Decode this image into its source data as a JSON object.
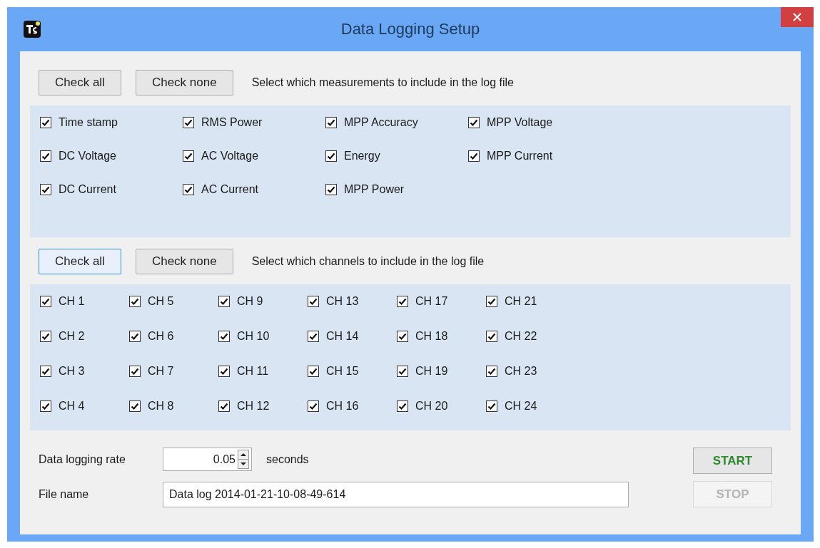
{
  "window": {
    "title": "Data Logging Setup"
  },
  "measurements": {
    "buttons": [
      {
        "label": "Check all",
        "focused": false
      },
      {
        "label": "Check none",
        "focused": false
      }
    ],
    "hint": "Select which measurements to include in the log file",
    "items": [
      {
        "label": "Time stamp",
        "checked": true
      },
      {
        "label": "DC Voltage",
        "checked": true
      },
      {
        "label": "DC Current",
        "checked": true
      },
      {
        "label": "RMS Power",
        "checked": true
      },
      {
        "label": "AC Voltage",
        "checked": true
      },
      {
        "label": "AC Current",
        "checked": true
      },
      {
        "label": "MPP Accuracy",
        "checked": true
      },
      {
        "label": "Energy",
        "checked": true
      },
      {
        "label": "MPP Power",
        "checked": true
      },
      {
        "label": "MPP Voltage",
        "checked": true
      },
      {
        "label": "MPP Current",
        "checked": true
      }
    ]
  },
  "channels": {
    "buttons": [
      {
        "label": "Check all",
        "focused": true
      },
      {
        "label": "Check none",
        "focused": false
      }
    ],
    "hint": "Select which channels to include in the log file",
    "items": [
      {
        "label": "CH 1",
        "checked": true
      },
      {
        "label": "CH 2",
        "checked": true
      },
      {
        "label": "CH 3",
        "checked": true
      },
      {
        "label": "CH 4",
        "checked": true
      },
      {
        "label": "CH 5",
        "checked": true
      },
      {
        "label": "CH 6",
        "checked": true
      },
      {
        "label": "CH 7",
        "checked": true
      },
      {
        "label": "CH 8",
        "checked": true
      },
      {
        "label": "CH 9",
        "checked": true
      },
      {
        "label": "CH 10",
        "checked": true
      },
      {
        "label": "CH 11",
        "checked": true
      },
      {
        "label": "CH 12",
        "checked": true
      },
      {
        "label": "CH 13",
        "checked": true
      },
      {
        "label": "CH 14",
        "checked": true
      },
      {
        "label": "CH 15",
        "checked": true
      },
      {
        "label": "CH 16",
        "checked": true
      },
      {
        "label": "CH 17",
        "checked": true
      },
      {
        "label": "CH 18",
        "checked": true
      },
      {
        "label": "CH 19",
        "checked": true
      },
      {
        "label": "CH 20",
        "checked": true
      },
      {
        "label": "CH 21",
        "checked": true
      },
      {
        "label": "CH 22",
        "checked": true
      },
      {
        "label": "CH 23",
        "checked": true
      },
      {
        "label": "CH 24",
        "checked": true
      }
    ]
  },
  "rate": {
    "label": "Data logging rate",
    "value": "0.05",
    "unit": "seconds"
  },
  "file": {
    "label": "File name",
    "value": "Data log 2014-01-21-10-08-49-614"
  },
  "actions": [
    {
      "label": "START",
      "disabled": false
    },
    {
      "label": "STOP",
      "disabled": true
    }
  ]
}
